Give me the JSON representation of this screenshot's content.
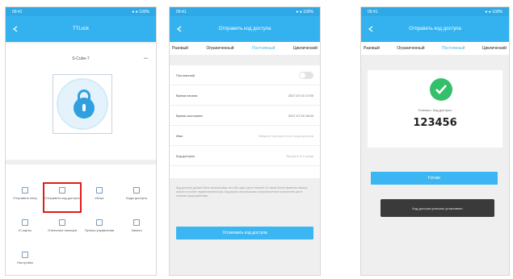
{
  "status": {
    "time": "09:41",
    "icons": "● ● 100%"
  },
  "screen1": {
    "title": "TTLock",
    "lock_name": "S-Cube-7",
    "tiles": [
      {
        "label": "Отправить ekey"
      },
      {
        "label": "Отправить код доступа"
      },
      {
        "label": "eKeys"
      },
      {
        "label": "Коды доступа"
      },
      {
        "label": "IC-карты"
      },
      {
        "label": "Отпечатки пальцев"
      },
      {
        "label": "Пульты управления"
      },
      {
        "label": "Записи"
      },
      {
        "label": "Настройки"
      }
    ]
  },
  "screen2": {
    "title": "Отправить код доступа",
    "tabs": [
      "Разовый",
      "Ограниченный",
      "Постоянный",
      "Циклический"
    ],
    "active_tab": 2,
    "fields": [
      {
        "label": "Постоянный",
        "value": ""
      },
      {
        "label": "Время начала",
        "value": "2017.07.03 17:00"
      },
      {
        "label": "Время окончания",
        "value": "2017.07.03 18:00"
      },
      {
        "label": "Имя",
        "placeholder": "Введите имя для этого кода доступа"
      },
      {
        "label": "Код доступа",
        "placeholder": "Введите 6-9 цифр"
      }
    ],
    "note": "Код доступа должен быть использован хотя бы один раз в течение 24 часов после времени начала, иначе он станет недействительным. Код можно использовать неограниченное количество раз в течение срока действия.",
    "button": "Установить код доступа"
  },
  "screen3": {
    "title": "Отправить код доступа",
    "tabs": [
      "Разовый",
      "Ограниченный",
      "Постоянный",
      "Циклический"
    ],
    "active_tab": 2,
    "success_label": "Успешно. Код доступа:",
    "code": "123456",
    "button": "Готово",
    "toast": "Код доступа успешно установлен"
  }
}
